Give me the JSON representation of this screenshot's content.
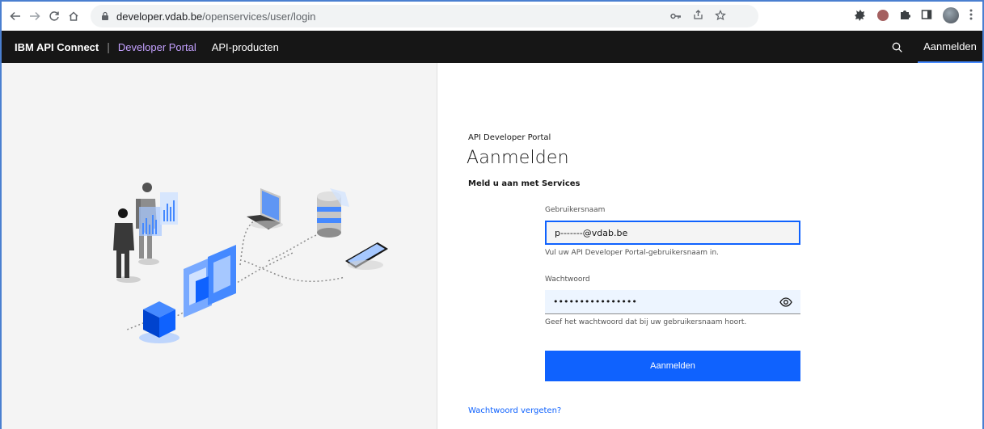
{
  "browser": {
    "url_host": "developer.vdab.be",
    "url_path": "/openservices/user/login"
  },
  "header": {
    "brand": "IBM API Connect",
    "separator": "|",
    "portal": "Developer Portal",
    "nav_products": "API-producten",
    "login_tab": "Aanmelden"
  },
  "login": {
    "kicker": "API Developer Portal",
    "title": "Aanmelden",
    "subtitle": "Meld u aan met Services",
    "username_label": "Gebruikersnaam",
    "username_value": "p-------@vdab.be",
    "username_help": "Vul uw API Developer Portal-gebruikersnaam in.",
    "password_label": "Wachtwoord",
    "password_value": "••••••••••••••••",
    "password_help": "Geef het wachtwoord dat bij uw gebruikersnaam hoort.",
    "submit_label": "Aanmelden",
    "forgot_link": "Wachtwoord vergeten?"
  },
  "colors": {
    "appbar_bg": "#161616",
    "portal_link": "#c4a1ff",
    "primary_button": "#0f62fe",
    "left_panel": "#f4f4f4"
  },
  "icons": [
    "back-arrow-icon",
    "forward-arrow-icon",
    "reload-icon",
    "home-icon",
    "lock-icon",
    "key-icon",
    "share-icon",
    "star-icon",
    "puzzle-icon",
    "search-icon",
    "eye-icon"
  ]
}
